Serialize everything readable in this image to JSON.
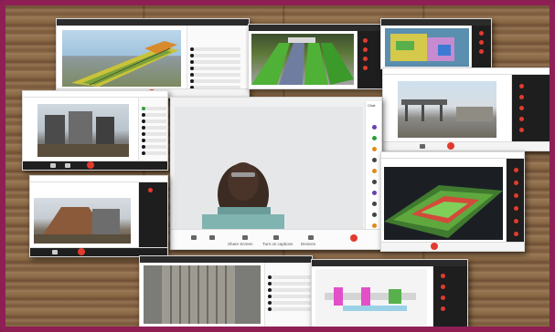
{
  "collage": {
    "description_colors": {
      "frame": "#8e1f55",
      "wood": "#8b6a4a",
      "end_call": "#e23b2e"
    },
    "center_window": {
      "toolbar": [
        "Share Screen",
        "Turn on captions",
        "Devices",
        "Leave"
      ],
      "icons": [
        "microphone-icon",
        "camera-icon",
        "share-screen-icon",
        "captions-icon",
        "devices-icon",
        "more-icon"
      ]
    },
    "side_panel_label": "Chat",
    "window_titles": [
      "",
      "",
      "",
      "",
      "",
      "",
      "",
      ""
    ]
  }
}
